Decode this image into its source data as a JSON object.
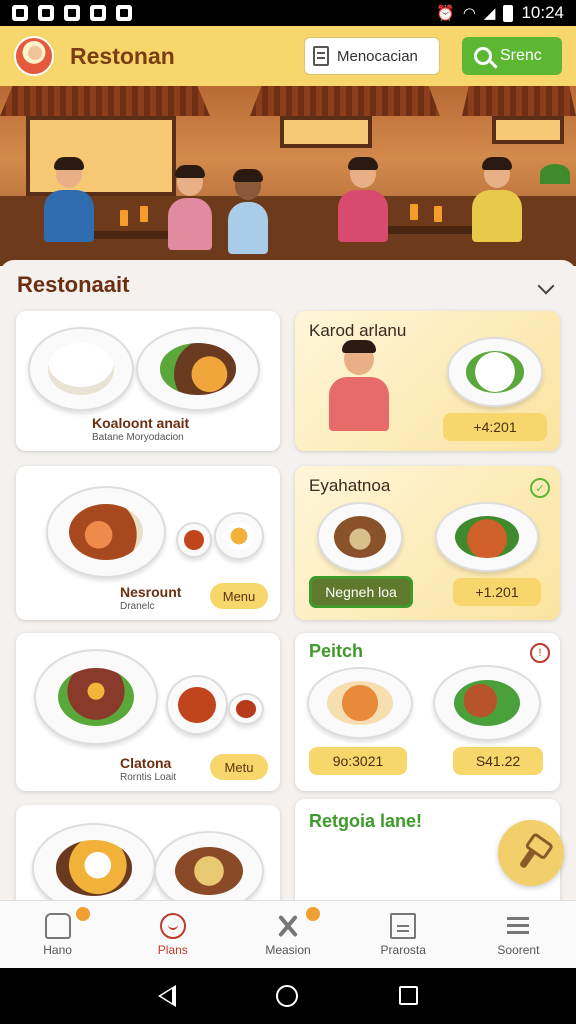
{
  "status_bar": {
    "time": "10:24"
  },
  "header": {
    "title": "Restonan",
    "mode_label": "Menocacian",
    "search_label": "Srenc"
  },
  "section": {
    "title": "Restonaait"
  },
  "cards": [
    {
      "name": "Koaloont anait",
      "sub": "Batane Moryodacion"
    },
    {
      "title": "Karod arlanu",
      "price": "+4:201"
    },
    {
      "name": "Nesrount",
      "sub": "Dranelc",
      "button": "Menu"
    },
    {
      "title": "Eyahatnoa",
      "button": "Negneh loa",
      "price": "+1.201"
    },
    {
      "name": "Clatona",
      "sub": "Rorntis Loait",
      "button": "Metu"
    },
    {
      "title": "Peitch",
      "price_left": "9o:3021",
      "price_right": "S41.22"
    },
    {
      "title": "Retgoia lane!"
    }
  ],
  "nav": {
    "items": [
      {
        "label": "Hano",
        "icon": "home-icon",
        "badge": true
      },
      {
        "label": "Plans",
        "icon": "smile-icon",
        "active": true
      },
      {
        "label": "Measion",
        "icon": "tools-icon",
        "badge": true
      },
      {
        "label": "Prarosta",
        "icon": "document-icon"
      },
      {
        "label": "Soorent",
        "icon": "list-icon"
      }
    ]
  },
  "colors": {
    "brand_yellow": "#f7d66b",
    "accent_green": "#5cb833",
    "title_brown": "#6b2f10",
    "active_red": "#c0392b"
  }
}
